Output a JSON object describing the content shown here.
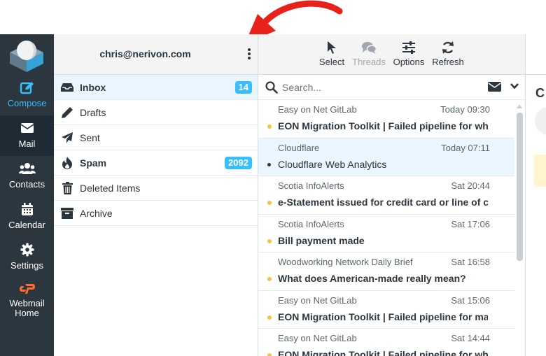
{
  "nav": {
    "items": [
      {
        "label": "Compose",
        "icon": "compose-icon"
      },
      {
        "label": "Mail",
        "icon": "mail-icon"
      },
      {
        "label": "Contacts",
        "icon": "contacts-icon"
      },
      {
        "label": "Calendar",
        "icon": "calendar-icon"
      },
      {
        "label": "Settings",
        "icon": "gear-icon"
      },
      {
        "label": "Webmail Home",
        "icon": "cpanel-logo-icon"
      }
    ],
    "active": "Mail"
  },
  "account": {
    "email": "chris@nerivon.com"
  },
  "folders": [
    {
      "label": "Inbox",
      "icon": "inbox-icon",
      "badge": "14",
      "selected": true,
      "bold": true
    },
    {
      "label": "Drafts",
      "icon": "pencil-icon",
      "badge": "",
      "bold": false
    },
    {
      "label": "Sent",
      "icon": "paper-plane-icon",
      "badge": "",
      "bold": false
    },
    {
      "label": "Spam",
      "icon": "fire-icon",
      "badge": "2092",
      "bold": true
    },
    {
      "label": "Deleted Items",
      "icon": "trash-icon",
      "badge": "",
      "bold": false
    },
    {
      "label": "Archive",
      "icon": "archive-icon",
      "badge": "",
      "bold": false
    }
  ],
  "toolbar": {
    "select_label": "Select",
    "threads_label": "Threads",
    "options_label": "Options",
    "refresh_label": "Refresh"
  },
  "search": {
    "placeholder": "Search..."
  },
  "messages": [
    {
      "sender": "Easy on Net GitLab",
      "date": "Today 09:30",
      "subject": "EON Migration Toolkit | Failed pipeline for wh...",
      "unread": true
    },
    {
      "sender": "Cloudflare",
      "date": "Today 07:11",
      "subject": "Cloudflare Web Analytics",
      "unread": false,
      "selected": true
    },
    {
      "sender": "Scotia InfoAlerts",
      "date": "Sat 20:44",
      "subject": "e-Statement issued for credit card or line of cr...",
      "unread": true
    },
    {
      "sender": "Scotia InfoAlerts",
      "date": "Sat 17:06",
      "subject": "Bill payment made",
      "unread": true
    },
    {
      "sender": "Woodworking Network Daily Brief",
      "date": "Sat 16:58",
      "subject": "What does American-made really mean?",
      "unread": true
    },
    {
      "sender": "Easy on Net GitLab",
      "date": "Sat 15:06",
      "subject": "EON Migration Toolkit | Failed pipeline for mai...",
      "unread": true
    },
    {
      "sender": "Easy on Net GitLab",
      "date": "Sat 14:44",
      "subject": "EON Migration Toolkit | Failed pipeline for wh...",
      "unread": true
    }
  ],
  "preview": {
    "title_fragment": "C"
  },
  "colors": {
    "nav_bg": "#2c363f",
    "accent": "#37beff",
    "unread_dot": "#f4c343",
    "annotation_arrow": "#e8221b",
    "cpanel_orange": "#ff6c2c"
  }
}
